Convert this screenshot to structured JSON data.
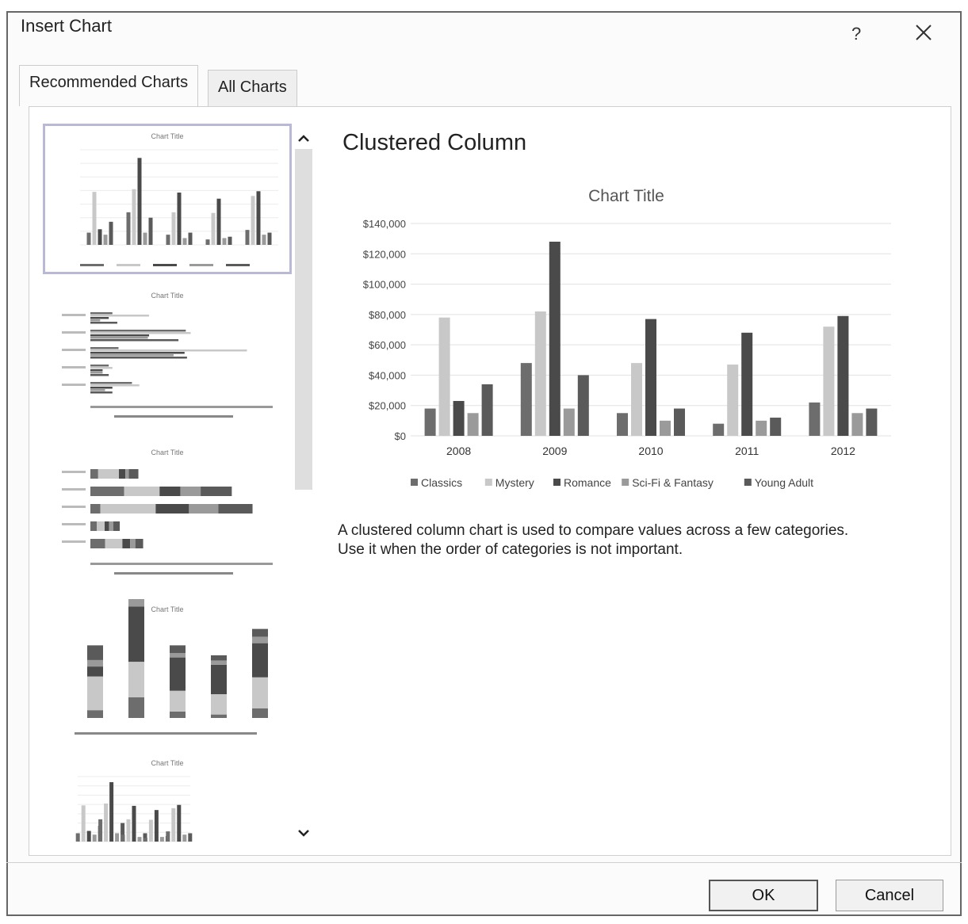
{
  "dialog": {
    "title": "Insert Chart",
    "help": "?",
    "close_icon": "close-icon"
  },
  "tabs": [
    {
      "label": "Recommended Charts",
      "selected": true
    },
    {
      "label": "All Charts",
      "selected": false
    }
  ],
  "thumbnails": [
    {
      "title": "Chart Title",
      "kind": "clustered-column",
      "selected": true
    },
    {
      "title": "Chart Title",
      "kind": "clustered-bar",
      "selected": false
    },
    {
      "title": "Chart Title",
      "kind": "stacked-bar",
      "selected": false
    },
    {
      "title": "Chart Title",
      "kind": "stacked-column",
      "selected": false
    },
    {
      "title": "Chart Title",
      "kind": "clustered-column",
      "selected": false
    }
  ],
  "preview": {
    "chart_type_name": "Clustered Column",
    "description_line1": "A clustered column chart is used to compare values across a few categories.",
    "description_line2": "Use it when the order of categories is not important."
  },
  "chart_data": {
    "type": "bar",
    "title": "Chart Title",
    "categories": [
      "2008",
      "2009",
      "2010",
      "2011",
      "2012"
    ],
    "y_tick_labels": [
      "$0",
      "$20,000",
      "$40,000",
      "$60,000",
      "$80,000",
      "$100,000",
      "$120,000",
      "$140,000"
    ],
    "ylim": [
      0,
      140000
    ],
    "grid": true,
    "legend_position": "bottom",
    "series": [
      {
        "name": "Classics",
        "color": "#6d6d6d",
        "values": [
          18000,
          48000,
          15000,
          8000,
          22000
        ]
      },
      {
        "name": "Mystery",
        "color": "#c8c8c8",
        "values": [
          78000,
          82000,
          48000,
          47000,
          72000
        ]
      },
      {
        "name": "Romance",
        "color": "#4a4a4a",
        "values": [
          23000,
          128000,
          77000,
          68000,
          79000
        ]
      },
      {
        "name": "Sci-Fi & Fantasy",
        "color": "#9a9a9a",
        "values": [
          15000,
          18000,
          10000,
          10000,
          15000
        ]
      },
      {
        "name": "Young Adult",
        "color": "#5a5a5a",
        "values": [
          34000,
          40000,
          18000,
          12000,
          18000
        ]
      }
    ]
  },
  "buttons": {
    "ok": "OK",
    "cancel": "Cancel"
  }
}
